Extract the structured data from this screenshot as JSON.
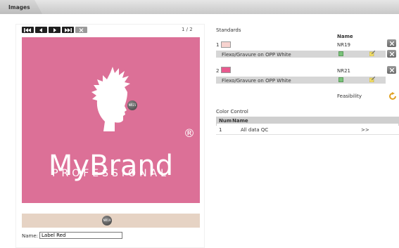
{
  "window": {
    "title": "Images"
  },
  "left": {
    "pager": "1 / 2",
    "preview": {
      "brand": "MyBrand",
      "reg_mark": "®",
      "subtitle": "PROFESSIONAL",
      "badge_main": "NR21",
      "badge_strip": "NR19"
    },
    "name_label": "Name:",
    "name_value": "Label Red"
  },
  "standards": {
    "title": "Standards",
    "name_header": "Name",
    "items": [
      {
        "num": "1",
        "name": "NR19",
        "substrate": "Flexo/Gravure on OPP White",
        "color": "#f7d3cf"
      },
      {
        "num": "2",
        "name": "NR21",
        "substrate": "Flexo/Gravure on OPP White",
        "color": "#e85a8f"
      }
    ],
    "feasibility_label": "Feasibility"
  },
  "color_control": {
    "title": "Color Control",
    "headers": [
      "Num",
      "Name"
    ],
    "rows": [
      {
        "num": "1",
        "name": "All data QC",
        "action": ">>"
      }
    ]
  }
}
